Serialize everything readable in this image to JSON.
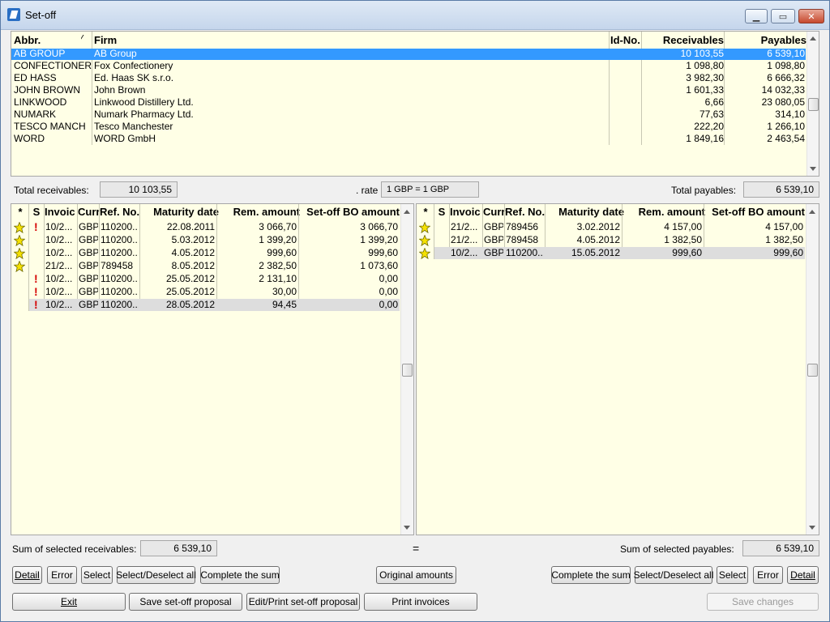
{
  "window": {
    "title": "Set-off"
  },
  "firms": {
    "columns": {
      "abbr": "Abbr.",
      "firm": "Firm",
      "id_no": "Id-No.",
      "receivables": "Receivables",
      "payables": "Payables"
    },
    "rows": [
      {
        "abbr": "AB GROUP",
        "firm": "AB Group",
        "id_no": "",
        "receivables": "10 103,55",
        "payables": "6 539,10"
      },
      {
        "abbr": "CONFECTIONERY",
        "firm": "Fox Confectionery",
        "id_no": "",
        "receivables": "1 098,80",
        "payables": "1 098,80"
      },
      {
        "abbr": "ED HASS",
        "firm": "Ed. Haas SK s.r.o.",
        "id_no": "",
        "receivables": "3 982,30",
        "payables": "6 666,32"
      },
      {
        "abbr": "JOHN BROWN",
        "firm": "John Brown",
        "id_no": "",
        "receivables": "1 601,33",
        "payables": "14 032,33"
      },
      {
        "abbr": "LINKWOOD",
        "firm": "Linkwood Distillery Ltd.",
        "id_no": "",
        "receivables": "6,66",
        "payables": "23 080,05"
      },
      {
        "abbr": "NUMARK",
        "firm": "Numark Pharmacy Ltd.",
        "id_no": "",
        "receivables": "77,63",
        "payables": "314,10"
      },
      {
        "abbr": "TESCO MANCH",
        "firm": "Tesco Manchester",
        "id_no": "",
        "receivables": "222,20",
        "payables": "1 266,10"
      },
      {
        "abbr": "WORD",
        "firm": "WORD GmbH",
        "id_no": "",
        "receivables": "1 849,16",
        "payables": "2 463,54"
      }
    ]
  },
  "totals": {
    "total_receivables_label": "Total receivables:",
    "total_receivables_value": "10 103,55",
    "rate_label": ". rate",
    "rate_value": "1 GBP = 1 GBP",
    "total_payables_label": "Total payables:",
    "total_payables_value": "6 539,10"
  },
  "doc_columns": {
    "star": "*",
    "s": "S",
    "invoice": "Invoic",
    "currency": "Curr",
    "ref_no": "Ref. No.",
    "maturity": "Maturity date",
    "rem_amount": "Rem. amount",
    "setoff": "Set-off BO amount"
  },
  "receivables": {
    "rows": [
      {
        "star": true,
        "excl": true,
        "invoice": "10/2...",
        "currency": "GBP",
        "ref_no": "110200...",
        "maturity": "22.08.2011",
        "rem_amount": "3 066,70",
        "setoff": "3 066,70"
      },
      {
        "star": true,
        "excl": false,
        "invoice": "10/2...",
        "currency": "GBP",
        "ref_no": "110200...",
        "maturity": "5.03.2012",
        "rem_amount": "1 399,20",
        "setoff": "1 399,20"
      },
      {
        "star": true,
        "excl": false,
        "invoice": "10/2...",
        "currency": "GBP",
        "ref_no": "110200...",
        "maturity": "4.05.2012",
        "rem_amount": "999,60",
        "setoff": "999,60"
      },
      {
        "star": true,
        "excl": false,
        "invoice": "21/2...",
        "currency": "GBP",
        "ref_no": "789458",
        "maturity": "8.05.2012",
        "rem_amount": "2 382,50",
        "setoff": "1 073,60"
      },
      {
        "star": false,
        "excl": true,
        "invoice": "10/2...",
        "currency": "GBP",
        "ref_no": "110200...",
        "maturity": "25.05.2012",
        "rem_amount": "2 131,10",
        "setoff": "0,00"
      },
      {
        "star": false,
        "excl": true,
        "invoice": "10/2...",
        "currency": "GBP",
        "ref_no": "110200...",
        "maturity": "25.05.2012",
        "rem_amount": "30,00",
        "setoff": "0,00"
      },
      {
        "star": false,
        "excl": true,
        "invoice": "10/2...",
        "currency": "GBP",
        "ref_no": "110200...",
        "maturity": "28.05.2012",
        "rem_amount": "94,45",
        "setoff": "0,00"
      }
    ]
  },
  "payables": {
    "rows": [
      {
        "star": true,
        "excl": false,
        "invoice": "21/2...",
        "currency": "GBP",
        "ref_no": "789456",
        "maturity": "3.02.2012",
        "rem_amount": "4 157,00",
        "setoff": "4 157,00"
      },
      {
        "star": true,
        "excl": false,
        "invoice": "21/2...",
        "currency": "GBP",
        "ref_no": "789458",
        "maturity": "4.05.2012",
        "rem_amount": "1 382,50",
        "setoff": "1 382,50"
      },
      {
        "star": true,
        "excl": false,
        "invoice": "10/2...",
        "currency": "GBP",
        "ref_no": "110200...",
        "maturity": "15.05.2012",
        "rem_amount": "999,60",
        "setoff": "999,60"
      }
    ]
  },
  "sums": {
    "receivables_label": "Sum of selected receivables:",
    "receivables_value": "6 539,10",
    "equals": "=",
    "payables_label": "Sum of selected payables:",
    "payables_value": "6 539,10"
  },
  "buttons": {
    "detail": "Detail",
    "error": "Error",
    "select": "Select",
    "select_deselect_all": "Select/Deselect all",
    "complete_sum": "Complete the sum",
    "original_amounts": "Original amounts",
    "exit": "Exit",
    "save_proposal": "Save set-off proposal",
    "edit_print_proposal": "Edit/Print set-off proposal",
    "print_invoices": "Print invoices",
    "save_changes": "Save changes"
  },
  "icons": {
    "star": "star-icon",
    "exclamation": "exclamation-icon",
    "sort": "sort-indicator-icon"
  },
  "colors": {
    "grid_bg": "#ffffe6",
    "selection": "#3399ff",
    "star_fill": "#f5e100",
    "exclamation": "#d40000"
  }
}
